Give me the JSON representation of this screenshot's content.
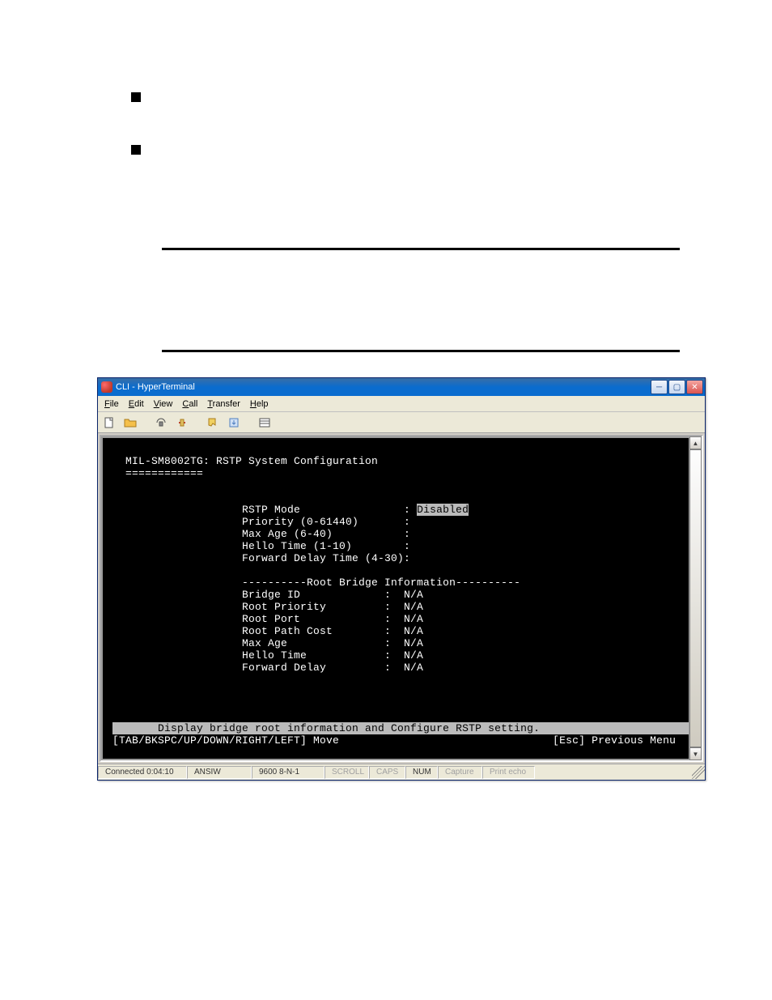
{
  "bullets": {
    "b1": "",
    "b2": ""
  },
  "window": {
    "title": "CLI - HyperTerminal",
    "menu": {
      "file": "File",
      "edit": "Edit",
      "view": "View",
      "call": "Call",
      "transfer": "Transfer",
      "help": "Help"
    },
    "toolbar_icons": [
      "new-file-icon",
      "open-folder-icon",
      "save-icon",
      "properties-icon",
      "connect-icon",
      "disconnect-icon",
      "send-icon"
    ]
  },
  "terminal": {
    "header_line": "MIL-SM8002TG: RSTP System Configuration",
    "underline": "============",
    "config": [
      {
        "label": "RSTP Mode",
        "value": "Disabled",
        "highlight": true
      },
      {
        "label": "Priority (0-61440)",
        "value": ""
      },
      {
        "label": "Max Age (6-40)",
        "value": ""
      },
      {
        "label": "Hello Time (1-10)",
        "value": ""
      },
      {
        "label": "Forward Delay Time (4-30)",
        "value": ""
      }
    ],
    "root_header": "----------Root Bridge Information----------",
    "root_info": [
      {
        "label": "Bridge ID",
        "value": "N/A"
      },
      {
        "label": "Root Priority",
        "value": "N/A"
      },
      {
        "label": "Root Port",
        "value": "N/A"
      },
      {
        "label": "Root Path Cost",
        "value": "N/A"
      },
      {
        "label": "Max Age",
        "value": "N/A"
      },
      {
        "label": "Hello Time",
        "value": "N/A"
      },
      {
        "label": "Forward Delay",
        "value": "N/A"
      }
    ],
    "help_bar": "Display bridge root information and Configure RSTP setting.",
    "nav_left": "[TAB/BKSPC/UP/DOWN/RIGHT/LEFT] Move",
    "nav_right": "[Esc] Previous Menu"
  },
  "statusbar": {
    "connected": "Connected 0:04:10",
    "term": "ANSIW",
    "baud": "9600 8-N-1",
    "scroll": "SCROLL",
    "caps": "CAPS",
    "num": "NUM",
    "capture": "Capture",
    "printecho": "Print echo"
  }
}
